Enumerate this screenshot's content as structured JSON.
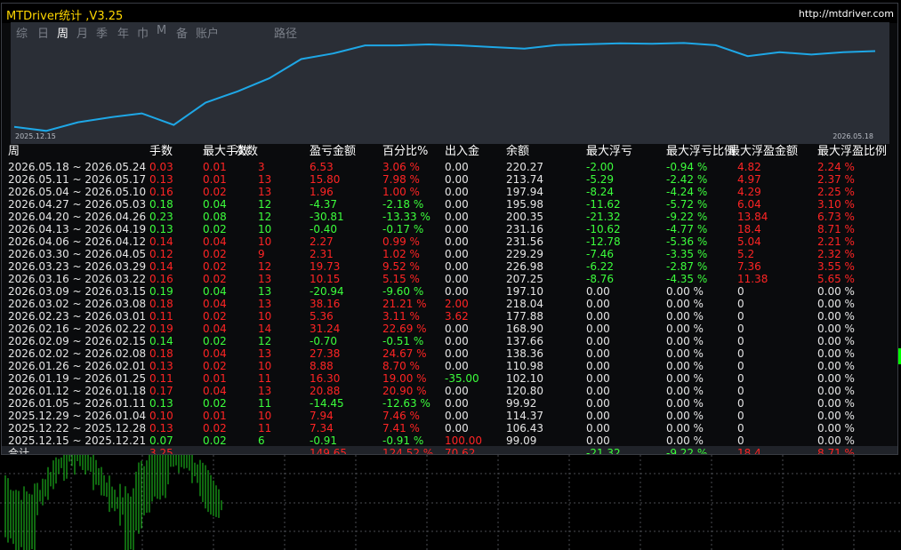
{
  "title": "MTDriver统计 ,V3.25",
  "url": "http://mtdriver.com",
  "tabs": [
    {
      "label": "综"
    },
    {
      "label": "日"
    },
    {
      "label": "周",
      "active": true
    },
    {
      "label": "月"
    },
    {
      "label": "季"
    },
    {
      "label": "年"
    },
    {
      "label": "巾"
    },
    {
      "label": "M"
    },
    {
      "label": "备"
    },
    {
      "label": "账户"
    },
    {
      "label": "路径"
    }
  ],
  "chart": {
    "date_start": "2025.12.15",
    "date_end": "2026.05.18",
    "line_color": "#1ea7e6",
    "balance_series": [
      99.09,
      92.5,
      106.43,
      114.37,
      120.8,
      102.1,
      138.36,
      156.5,
      177.88,
      209,
      218.04,
      231.16,
      231.16,
      232.8,
      231.16,
      228.5,
      225.84,
      231.74,
      233.14,
      234.5,
      233.9,
      235.1,
      231.48,
      213.74,
      220.27,
      216.4,
      220.27,
      222.0
    ]
  },
  "table": {
    "headers": [
      "周",
      "手数",
      "最大手数",
      "次数",
      "盈亏金额",
      "百分比%",
      "出入金",
      "余额",
      "最大浮亏",
      "最大浮亏比例",
      "最大浮盈金额",
      "最大浮盈比例"
    ],
    "rows": [
      {
        "period": "2026.05.18 ~ 2026.05.24",
        "lots": "0.03",
        "max_lots": "0.01",
        "count": "3",
        "pnl": "6.53",
        "pct": "3.06 %",
        "flow": "0.00",
        "balance": "220.27",
        "max_dd": "-2.00",
        "max_dd_pct": "-0.94 %",
        "max_fp": "4.82",
        "max_fp_pct": "2.24 %",
        "pos": true
      },
      {
        "period": "2026.05.11 ~ 2026.05.17",
        "lots": "0.13",
        "max_lots": "0.01",
        "count": "13",
        "pnl": "15.80",
        "pct": "7.98 %",
        "flow": "0.00",
        "balance": "213.74",
        "max_dd": "-5.29",
        "max_dd_pct": "-2.42 %",
        "max_fp": "4.97",
        "max_fp_pct": "2.37 %",
        "pos": true
      },
      {
        "period": "2026.05.04 ~ 2026.05.10",
        "lots": "0.16",
        "max_lots": "0.02",
        "count": "13",
        "pnl": "1.96",
        "pct": "1.00 %",
        "flow": "0.00",
        "balance": "197.94",
        "max_dd": "-8.24",
        "max_dd_pct": "-4.24 %",
        "max_fp": "4.29",
        "max_fp_pct": "2.25 %",
        "pos": true
      },
      {
        "period": "2026.04.27 ~ 2026.05.03",
        "lots": "0.18",
        "max_lots": "0.04",
        "count": "12",
        "pnl": "-4.37",
        "pct": "-2.18 %",
        "flow": "0.00",
        "balance": "195.98",
        "max_dd": "-11.62",
        "max_dd_pct": "-5.72 %",
        "max_fp": "6.04",
        "max_fp_pct": "3.10 %",
        "pos": false
      },
      {
        "period": "2026.04.20 ~ 2026.04.26",
        "lots": "0.23",
        "max_lots": "0.08",
        "count": "12",
        "pnl": "-30.81",
        "pct": "-13.33 %",
        "flow": "0.00",
        "balance": "200.35",
        "max_dd": "-21.32",
        "max_dd_pct": "-9.22 %",
        "max_fp": "13.84",
        "max_fp_pct": "6.73 %",
        "pos": false
      },
      {
        "period": "2026.04.13 ~ 2026.04.19",
        "lots": "0.13",
        "max_lots": "0.02",
        "count": "10",
        "pnl": "-0.40",
        "pct": "-0.17 %",
        "flow": "0.00",
        "balance": "231.16",
        "max_dd": "-10.62",
        "max_dd_pct": "-4.77 %",
        "max_fp": "18.4",
        "max_fp_pct": "8.71 %",
        "pos": false
      },
      {
        "period": "2026.04.06 ~ 2026.04.12",
        "lots": "0.14",
        "max_lots": "0.04",
        "count": "10",
        "pnl": "2.27",
        "pct": "0.99 %",
        "flow": "0.00",
        "balance": "231.56",
        "max_dd": "-12.78",
        "max_dd_pct": "-5.36 %",
        "max_fp": "5.04",
        "max_fp_pct": "2.21 %",
        "pos": true
      },
      {
        "period": "2026.03.30 ~ 2026.04.05",
        "lots": "0.12",
        "max_lots": "0.02",
        "count": "9",
        "pnl": "2.31",
        "pct": "1.02 %",
        "flow": "0.00",
        "balance": "229.29",
        "max_dd": "-7.46",
        "max_dd_pct": "-3.35 %",
        "max_fp": "5.2",
        "max_fp_pct": "2.32 %",
        "pos": true
      },
      {
        "period": "2026.03.23 ~ 2026.03.29",
        "lots": "0.14",
        "max_lots": "0.02",
        "count": "12",
        "pnl": "19.73",
        "pct": "9.52 %",
        "flow": "0.00",
        "balance": "226.98",
        "max_dd": "-6.22",
        "max_dd_pct": "-2.87 %",
        "max_fp": "7.36",
        "max_fp_pct": "3.55 %",
        "pos": true
      },
      {
        "period": "2026.03.16 ~ 2026.03.22",
        "lots": "0.16",
        "max_lots": "0.02",
        "count": "13",
        "pnl": "10.15",
        "pct": "5.15 %",
        "flow": "0.00",
        "balance": "207.25",
        "max_dd": "-8.76",
        "max_dd_pct": "-4.35 %",
        "max_fp": "11.38",
        "max_fp_pct": "5.65 %",
        "pos": true
      },
      {
        "period": "2026.03.09 ~ 2026.03.15",
        "lots": "0.19",
        "max_lots": "0.04",
        "count": "13",
        "pnl": "-20.94",
        "pct": "-9.60 %",
        "flow": "0.00",
        "balance": "197.10",
        "max_dd": "0.00",
        "max_dd_pct": "0.00 %",
        "max_fp": "0",
        "max_fp_pct": "0.00 %",
        "pos": false
      },
      {
        "period": "2026.03.02 ~ 2026.03.08",
        "lots": "0.18",
        "max_lots": "0.04",
        "count": "13",
        "pnl": "38.16",
        "pct": "21.21 %",
        "flow": "2.00",
        "balance": "218.04",
        "max_dd": "0.00",
        "max_dd_pct": "0.00 %",
        "max_fp": "0",
        "max_fp_pct": "0.00 %",
        "pos": true,
        "flowpos": true
      },
      {
        "period": "2026.02.23 ~ 2026.03.01",
        "lots": "0.11",
        "max_lots": "0.02",
        "count": "10",
        "pnl": "5.36",
        "pct": "3.11 %",
        "flow": "3.62",
        "balance": "177.88",
        "max_dd": "0.00",
        "max_dd_pct": "0.00 %",
        "max_fp": "0",
        "max_fp_pct": "0.00 %",
        "pos": true,
        "flowpos": true
      },
      {
        "period": "2026.02.16 ~ 2026.02.22",
        "lots": "0.19",
        "max_lots": "0.04",
        "count": "14",
        "pnl": "31.24",
        "pct": "22.69 %",
        "flow": "0.00",
        "balance": "168.90",
        "max_dd": "0.00",
        "max_dd_pct": "0.00 %",
        "max_fp": "0",
        "max_fp_pct": "0.00 %",
        "pos": true
      },
      {
        "period": "2026.02.09 ~ 2026.02.15",
        "lots": "0.14",
        "max_lots": "0.02",
        "count": "12",
        "pnl": "-0.70",
        "pct": "-0.51 %",
        "flow": "0.00",
        "balance": "137.66",
        "max_dd": "0.00",
        "max_dd_pct": "0.00 %",
        "max_fp": "0",
        "max_fp_pct": "0.00 %",
        "pos": false
      },
      {
        "period": "2026.02.02 ~ 2026.02.08",
        "lots": "0.18",
        "max_lots": "0.04",
        "count": "13",
        "pnl": "27.38",
        "pct": "24.67 %",
        "flow": "0.00",
        "balance": "138.36",
        "max_dd": "0.00",
        "max_dd_pct": "0.00 %",
        "max_fp": "0",
        "max_fp_pct": "0.00 %",
        "pos": true
      },
      {
        "period": "2026.01.26 ~ 2026.02.01",
        "lots": "0.13",
        "max_lots": "0.02",
        "count": "10",
        "pnl": "8.88",
        "pct": "8.70 %",
        "flow": "0.00",
        "balance": "110.98",
        "max_dd": "0.00",
        "max_dd_pct": "0.00 %",
        "max_fp": "0",
        "max_fp_pct": "0.00 %",
        "pos": true
      },
      {
        "period": "2026.01.19 ~ 2026.01.25",
        "lots": "0.11",
        "max_lots": "0.01",
        "count": "11",
        "pnl": "16.30",
        "pct": "19.00 %",
        "flow": "-35.00",
        "balance": "102.10",
        "max_dd": "0.00",
        "max_dd_pct": "0.00 %",
        "max_fp": "0",
        "max_fp_pct": "0.00 %",
        "pos": true,
        "flowneg": true
      },
      {
        "period": "2026.01.12 ~ 2026.01.18",
        "lots": "0.17",
        "max_lots": "0.04",
        "count": "13",
        "pnl": "20.88",
        "pct": "20.90 %",
        "flow": "0.00",
        "balance": "120.80",
        "max_dd": "0.00",
        "max_dd_pct": "0.00 %",
        "max_fp": "0",
        "max_fp_pct": "0.00 %",
        "pos": true
      },
      {
        "period": "2026.01.05 ~ 2026.01.11",
        "lots": "0.13",
        "max_lots": "0.02",
        "count": "11",
        "pnl": "-14.45",
        "pct": "-12.63 %",
        "flow": "0.00",
        "balance": "99.92",
        "max_dd": "0.00",
        "max_dd_pct": "0.00 %",
        "max_fp": "0",
        "max_fp_pct": "0.00 %",
        "pos": false
      },
      {
        "period": "2025.12.29 ~ 2026.01.04",
        "lots": "0.10",
        "max_lots": "0.01",
        "count": "10",
        "pnl": "7.94",
        "pct": "7.46 %",
        "flow": "0.00",
        "balance": "114.37",
        "max_dd": "0.00",
        "max_dd_pct": "0.00 %",
        "max_fp": "0",
        "max_fp_pct": "0.00 %",
        "pos": true
      },
      {
        "period": "2025.12.22 ~ 2025.12.28",
        "lots": "0.13",
        "max_lots": "0.02",
        "count": "11",
        "pnl": "7.34",
        "pct": "7.41 %",
        "flow": "0.00",
        "balance": "106.43",
        "max_dd": "0.00",
        "max_dd_pct": "0.00 %",
        "max_fp": "0",
        "max_fp_pct": "0.00 %",
        "pos": true
      },
      {
        "period": "2025.12.15 ~ 2025.12.21",
        "lots": "0.07",
        "max_lots": "0.02",
        "count": "6",
        "pnl": "-0.91",
        "pct": "-0.91 %",
        "flow": "100.00",
        "balance": "99.09",
        "max_dd": "0.00",
        "max_dd_pct": "0.00 %",
        "max_fp": "0",
        "max_fp_pct": "0.00 %",
        "pos": false,
        "flowpos": true
      }
    ],
    "total": {
      "label": "合计",
      "lots": "3.25",
      "pnl": "149.65",
      "pct": "124.52 %",
      "flow": "70.62",
      "max_dd": "-21.32",
      "max_dd_pct": "-9.22 %",
      "max_fp": "18.4",
      "max_fp_pct": "8.71 %"
    }
  },
  "colors": {
    "positive": "#ff2424",
    "negative": "#3cff3c",
    "neutral": "#e6e6e6",
    "title": "#ffd700"
  }
}
